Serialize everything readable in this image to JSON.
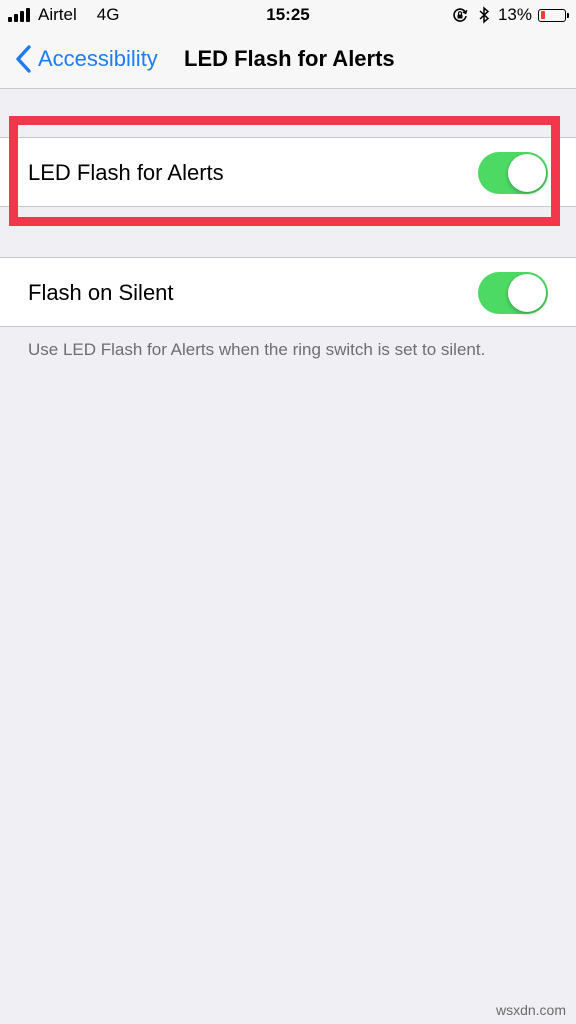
{
  "status_bar": {
    "carrier": "Airtel",
    "network": "4G",
    "time": "15:25",
    "battery_percent": "13%",
    "battery_level": 0.13,
    "icons": [
      "signal-icon",
      "orientation-lock-icon",
      "bluetooth-icon",
      "battery-icon"
    ]
  },
  "nav": {
    "back_label": "Accessibility",
    "title": "LED Flash for Alerts"
  },
  "settings": {
    "led_flash": {
      "label": "LED Flash for Alerts",
      "enabled": true
    },
    "flash_on_silent": {
      "label": "Flash on Silent",
      "enabled": true
    },
    "footer": "Use LED Flash for Alerts when the ring switch is set to silent."
  },
  "colors": {
    "accent": "#1f7cf5",
    "toggle_on": "#4cd964",
    "highlight": "#f2364b",
    "background": "#efeff4"
  },
  "watermark": "wsxdn.com"
}
